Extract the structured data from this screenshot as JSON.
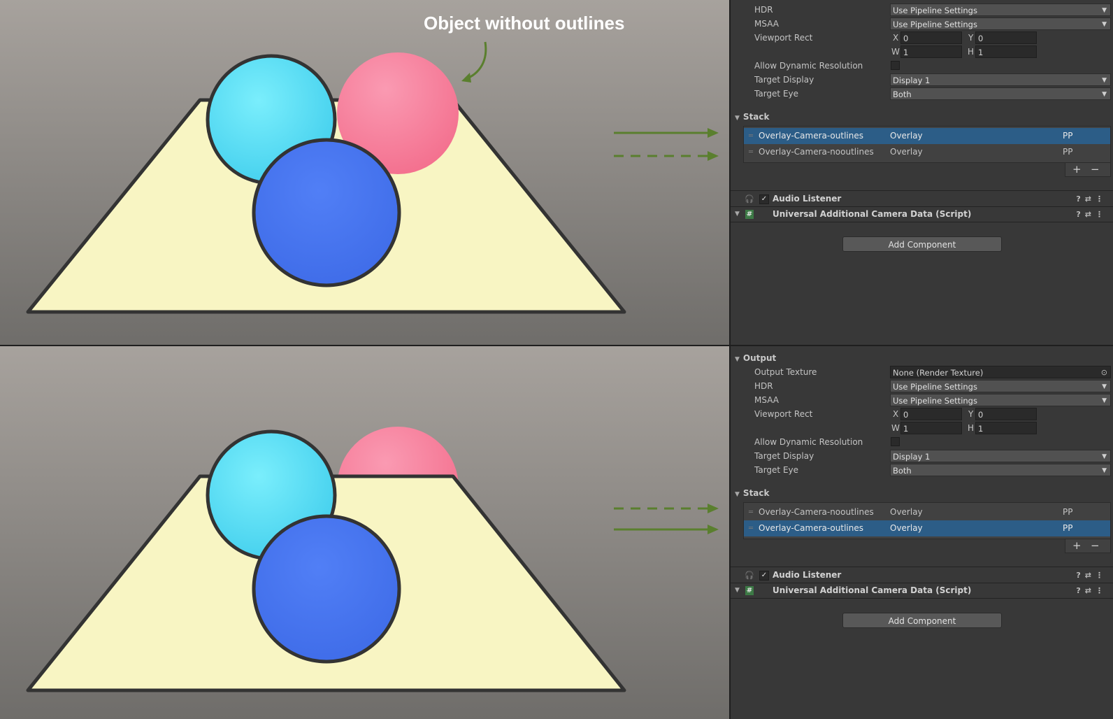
{
  "annotation": {
    "callout": "Object without outlines"
  },
  "colors": {
    "plane": "#f8f5c3",
    "sphere_cyan": "#5ee2f6",
    "sphere_pink": "#f57e9a",
    "sphere_blue": "#4a7af1",
    "arrow": "#5a7f2e",
    "selection": "#2c5d87"
  },
  "top_inspector": {
    "hdr_label": "HDR",
    "hdr_value": "Use Pipeline Settings",
    "msaa_label": "MSAA",
    "msaa_value": "Use Pipeline Settings",
    "viewport_label": "Viewport Rect",
    "vp_x_label": "X",
    "vp_x": "0",
    "vp_y_label": "Y",
    "vp_y": "0",
    "vp_w_label": "W",
    "vp_w": "1",
    "vp_h_label": "H",
    "vp_h": "1",
    "dynres_label": "Allow Dynamic Resolution",
    "target_display_label": "Target Display",
    "target_display_value": "Display 1",
    "target_eye_label": "Target Eye",
    "target_eye_value": "Both",
    "stack_label": "Stack",
    "stack": [
      {
        "name": "Overlay-Camera-outlines",
        "type": "Overlay",
        "pp": "PP"
      },
      {
        "name": "Overlay-Camera-nooutlines",
        "type": "Overlay",
        "pp": "PP"
      }
    ],
    "plus": "+",
    "minus": "−",
    "audio_listener": "Audio Listener",
    "camera_data": "Universal Additional Camera Data (Script)",
    "add_component": "Add Component"
  },
  "bottom_inspector": {
    "output_label": "Output",
    "output_texture_label": "Output Texture",
    "output_texture_value": "None (Render Texture)",
    "hdr_label": "HDR",
    "hdr_value": "Use Pipeline Settings",
    "msaa_label": "MSAA",
    "msaa_value": "Use Pipeline Settings",
    "viewport_label": "Viewport Rect",
    "vp_x_label": "X",
    "vp_x": "0",
    "vp_y_label": "Y",
    "vp_y": "0",
    "vp_w_label": "W",
    "vp_w": "1",
    "vp_h_label": "H",
    "vp_h": "1",
    "dynres_label": "Allow Dynamic Resolution",
    "target_display_label": "Target Display",
    "target_display_value": "Display 1",
    "target_eye_label": "Target Eye",
    "target_eye_value": "Both",
    "stack_label": "Stack",
    "stack": [
      {
        "name": "Overlay-Camera-nooutlines",
        "type": "Overlay",
        "pp": "PP"
      },
      {
        "name": "Overlay-Camera-outlines",
        "type": "Overlay",
        "pp": "PP"
      }
    ],
    "plus": "+",
    "minus": "−",
    "audio_listener": "Audio Listener",
    "camera_data": "Universal Additional Camera Data (Script)",
    "add_component": "Add Component"
  },
  "icons": {
    "dropdown": "chevron-down-icon",
    "foldout": "triangle-down-icon",
    "audio": "headphones-icon",
    "script": "script-hash-icon",
    "help": "help-icon",
    "presets": "presets-icon",
    "menu": "kebab-menu-icon",
    "object_picker": "object-picker-icon"
  }
}
